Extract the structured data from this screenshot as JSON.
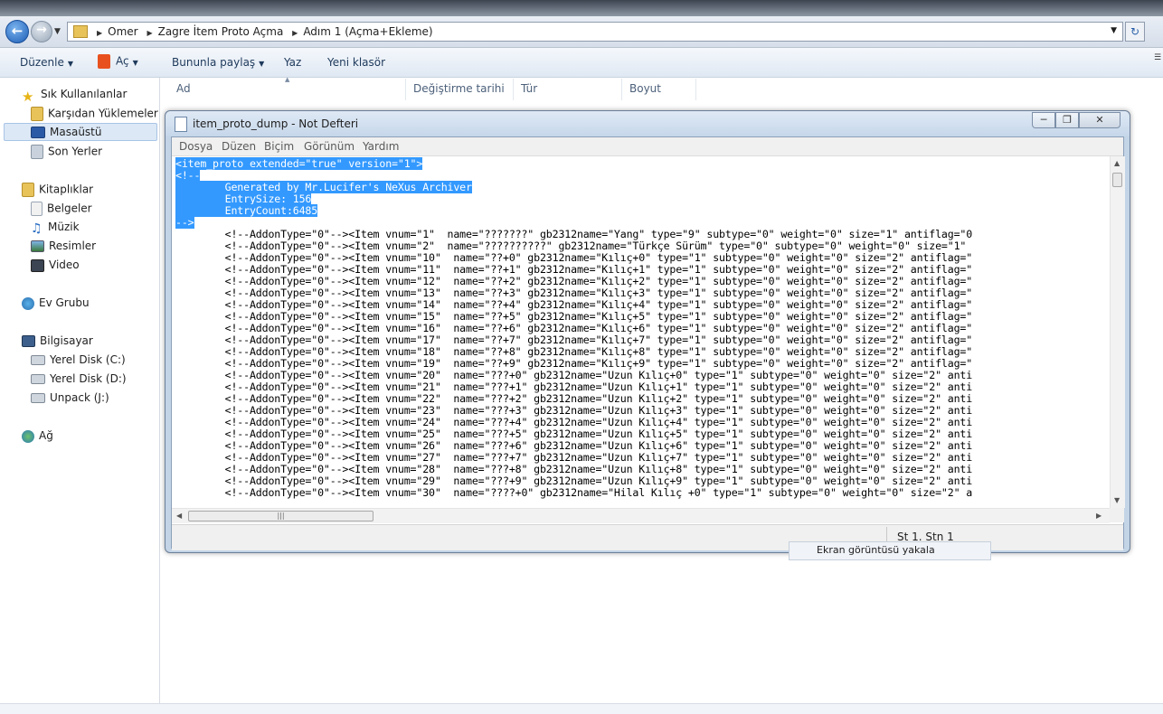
{
  "explorer": {
    "breadcrumbs": [
      "Omer",
      "Zagre İtem Proto Açma",
      "Adım 1 (Açma+Ekleme)"
    ],
    "toolbar": {
      "organize": "Düzenle",
      "open": "Aç",
      "share": "Bununla paylaş",
      "print": "Yaz",
      "new_folder": "Yeni klasör"
    },
    "columns": [
      "Ad",
      "Değiştirme tarihi",
      "Tür",
      "Boyut"
    ],
    "nav": {
      "favorites": "Sık Kullanılanlar",
      "downloads": "Karşıdan Yüklemeler",
      "desktop": "Masaüstü",
      "recent": "Son Yerler",
      "libraries": "Kitaplıklar",
      "documents": "Belgeler",
      "music": "Müzik",
      "pictures": "Resimler",
      "video": "Video",
      "homegroup": "Ev Grubu",
      "computer": "Bilgisayar",
      "disk_c": "Yerel Disk (C:)",
      "disk_d": "Yerel Disk (D:)",
      "unpack": "Unpack (J:)",
      "network": "Ağ"
    }
  },
  "notepad": {
    "title": "item_proto_dump - Not Defteri",
    "menu": [
      "Dosya",
      "Düzen",
      "Biçim",
      "Görünüm",
      "Yardım"
    ],
    "status": "St 1. Stn 1",
    "selected_lines": [
      "<item_proto extended=\"true\" version=\"1\">",
      "<!--",
      "        Generated by Mr.Lucifer's NeXus Archiver",
      "        EntrySize: 156",
      "        EntryCount:6485",
      "-->"
    ],
    "lines": [
      "        <!--AddonType=\"0\"--><Item vnum=\"1\"  name=\"???????\" gb2312name=\"Yang\" type=\"9\" subtype=\"0\" weight=\"0\" size=\"1\" antiflag=\"0",
      "        <!--AddonType=\"0\"--><Item vnum=\"2\"  name=\"??????????\" gb2312name=\"Türkçe Sürüm\" type=\"0\" subtype=\"0\" weight=\"0\" size=\"1\" ",
      "        <!--AddonType=\"0\"--><Item vnum=\"10\"  name=\"??+0\" gb2312name=\"Kılıç+0\" type=\"1\" subtype=\"0\" weight=\"0\" size=\"2\" antiflag=\"",
      "        <!--AddonType=\"0\"--><Item vnum=\"11\"  name=\"??+1\" gb2312name=\"Kılıç+1\" type=\"1\" subtype=\"0\" weight=\"0\" size=\"2\" antiflag=\"",
      "        <!--AddonType=\"0\"--><Item vnum=\"12\"  name=\"??+2\" gb2312name=\"Kılıç+2\" type=\"1\" subtype=\"0\" weight=\"0\" size=\"2\" antiflag=\"",
      "        <!--AddonType=\"0\"--><Item vnum=\"13\"  name=\"??+3\" gb2312name=\"Kılıç+3\" type=\"1\" subtype=\"0\" weight=\"0\" size=\"2\" antiflag=\"",
      "        <!--AddonType=\"0\"--><Item vnum=\"14\"  name=\"??+4\" gb2312name=\"Kılıç+4\" type=\"1\" subtype=\"0\" weight=\"0\" size=\"2\" antiflag=\"",
      "        <!--AddonType=\"0\"--><Item vnum=\"15\"  name=\"??+5\" gb2312name=\"Kılıç+5\" type=\"1\" subtype=\"0\" weight=\"0\" size=\"2\" antiflag=\"",
      "        <!--AddonType=\"0\"--><Item vnum=\"16\"  name=\"??+6\" gb2312name=\"Kılıç+6\" type=\"1\" subtype=\"0\" weight=\"0\" size=\"2\" antiflag=\"",
      "        <!--AddonType=\"0\"--><Item vnum=\"17\"  name=\"??+7\" gb2312name=\"Kılıç+7\" type=\"1\" subtype=\"0\" weight=\"0\" size=\"2\" antiflag=\"",
      "        <!--AddonType=\"0\"--><Item vnum=\"18\"  name=\"??+8\" gb2312name=\"Kılıç+8\" type=\"1\" subtype=\"0\" weight=\"0\" size=\"2\" antiflag=\"",
      "        <!--AddonType=\"0\"--><Item vnum=\"19\"  name=\"??+9\" gb2312name=\"Kılıç+9\" type=\"1\" subtype=\"0\" weight=\"0\" size=\"2\" antiflag=\"",
      "        <!--AddonType=\"0\"--><Item vnum=\"20\"  name=\"???+0\" gb2312name=\"Uzun Kılıç+0\" type=\"1\" subtype=\"0\" weight=\"0\" size=\"2\" anti",
      "        <!--AddonType=\"0\"--><Item vnum=\"21\"  name=\"???+1\" gb2312name=\"Uzun Kılıç+1\" type=\"1\" subtype=\"0\" weight=\"0\" size=\"2\" anti",
      "        <!--AddonType=\"0\"--><Item vnum=\"22\"  name=\"???+2\" gb2312name=\"Uzun Kılıç+2\" type=\"1\" subtype=\"0\" weight=\"0\" size=\"2\" anti",
      "        <!--AddonType=\"0\"--><Item vnum=\"23\"  name=\"???+3\" gb2312name=\"Uzun Kılıç+3\" type=\"1\" subtype=\"0\" weight=\"0\" size=\"2\" anti",
      "        <!--AddonType=\"0\"--><Item vnum=\"24\"  name=\"???+4\" gb2312name=\"Uzun Kılıç+4\" type=\"1\" subtype=\"0\" weight=\"0\" size=\"2\" anti",
      "        <!--AddonType=\"0\"--><Item vnum=\"25\"  name=\"???+5\" gb2312name=\"Uzun Kılıç+5\" type=\"1\" subtype=\"0\" weight=\"0\" size=\"2\" anti",
      "        <!--AddonType=\"0\"--><Item vnum=\"26\"  name=\"???+6\" gb2312name=\"Uzun Kılıç+6\" type=\"1\" subtype=\"0\" weight=\"0\" size=\"2\" anti",
      "        <!--AddonType=\"0\"--><Item vnum=\"27\"  name=\"???+7\" gb2312name=\"Uzun Kılıç+7\" type=\"1\" subtype=\"0\" weight=\"0\" size=\"2\" anti",
      "        <!--AddonType=\"0\"--><Item vnum=\"28\"  name=\"???+8\" gb2312name=\"Uzun Kılıç+8\" type=\"1\" subtype=\"0\" weight=\"0\" size=\"2\" anti",
      "        <!--AddonType=\"0\"--><Item vnum=\"29\"  name=\"???+9\" gb2312name=\"Uzun Kılıç+9\" type=\"1\" subtype=\"0\" weight=\"0\" size=\"2\" anti",
      "        <!--AddonType=\"0\"--><Item vnum=\"30\"  name=\"????+0\" gb2312name=\"Hilal Kılıç +0\" type=\"1\" subtype=\"0\" weight=\"0\" size=\"2\" a"
    ]
  },
  "context_menu": {
    "item": "Ekran görüntüsü yakala"
  },
  "colors": {
    "selection": "#3399ff",
    "window_frame": "#c3d4e7",
    "nav_selected": "#dce8f6"
  }
}
